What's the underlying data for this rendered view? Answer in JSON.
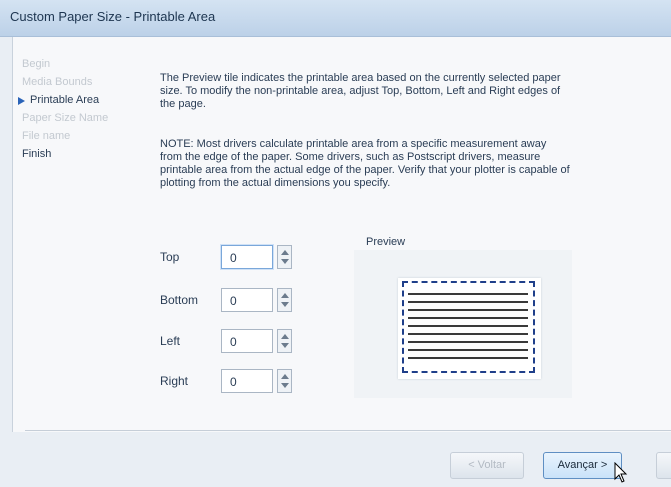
{
  "window": {
    "title": "Custom Paper Size - Printable Area"
  },
  "steps": [
    {
      "label": "Begin",
      "state": "disabled"
    },
    {
      "label": "Media Bounds",
      "state": "disabled"
    },
    {
      "label": "Printable Area",
      "state": "active"
    },
    {
      "label": "Paper Size Name",
      "state": "disabled"
    },
    {
      "label": "File name",
      "state": "disabled"
    },
    {
      "label": "Finish",
      "state": "enabled"
    }
  ],
  "description": {
    "paragraph1": "The Preview tile indicates the printable area based on the currently selected paper size. To modify the non-printable area, adjust Top, Bottom, Left and Right edges of the page.",
    "paragraph2": "NOTE: Most drivers calculate printable area from a specific measurement away from the edge of the paper. Some drivers, such as Postscript drivers, measure printable area from the actual edge of the paper. Verify that your plotter is capable of plotting from the actual dimensions you specify."
  },
  "fields": {
    "top": {
      "label": "Top",
      "value": "0"
    },
    "bottom": {
      "label": "Bottom",
      "value": "0"
    },
    "left": {
      "label": "Left",
      "value": "0"
    },
    "right": {
      "label": "Right",
      "value": "0"
    }
  },
  "preview": {
    "label": "Preview"
  },
  "buttons": {
    "back": "< Voltar",
    "next": "Avançar >"
  },
  "colors": {
    "accent": "#2a63b8",
    "preview_border": "#1f3f8a"
  }
}
